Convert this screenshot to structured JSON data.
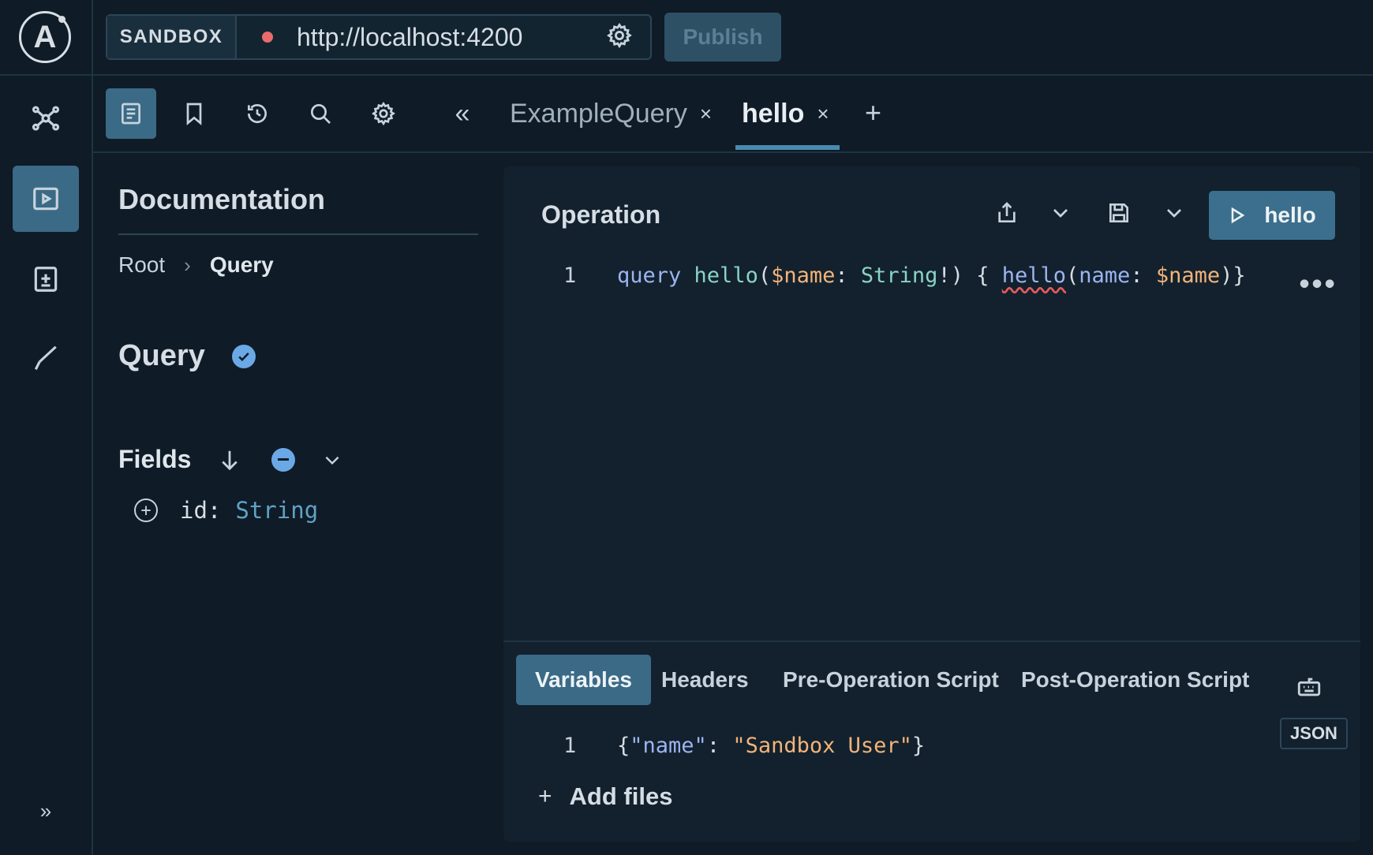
{
  "app": {
    "logo_letter": "A",
    "rail_expand": "»"
  },
  "topbar": {
    "mode_label": "SANDBOX",
    "endpoint_url": "http://localhost:4200",
    "publish_label": "Publish"
  },
  "tabs": [
    {
      "label": "ExampleQuery",
      "close": "×"
    },
    {
      "label": "hello",
      "close": "×"
    }
  ],
  "toolrow": {
    "collapse_glyph": "«",
    "new_tab": "+"
  },
  "docs": {
    "title": "Documentation",
    "breadcrumb": [
      "Root",
      "Query"
    ],
    "breadcrumb_sep": "›",
    "type_name": "Query",
    "fields_label": "Fields",
    "fields": [
      {
        "name": "id:",
        "type": "String"
      }
    ]
  },
  "operation": {
    "title": "Operation",
    "run_label": "hello",
    "line_number": "1",
    "code": {
      "kw": "query",
      "name": "hello",
      "open": "(",
      "var": "$name",
      "colon": ": ",
      "type": "String",
      "bang": "!",
      "close": ") { ",
      "field": "hello",
      "arg_open": "(",
      "arg": "name",
      "arg_colon": ": ",
      "arg_val": "$name",
      "end": ")}"
    },
    "more": "•••"
  },
  "bottom_tabs": [
    "Variables",
    "Headers",
    "Pre-Operation Script",
    "Post-Operation Script"
  ],
  "variables": {
    "format_badge": "JSON",
    "line_number": "1",
    "open": "{",
    "key": "\"name\"",
    "colon": ": ",
    "value": "\"Sandbox User\"",
    "close": "}",
    "add_files_label": "Add files",
    "add_files_plus": "+"
  },
  "colors": {
    "background": "#0f1b26",
    "accent": "#3a6a86",
    "status_dot": "#e86b6b",
    "verified": "#6aa9e6"
  },
  "icons": {
    "rail": [
      "schema-icon",
      "explorer-play-icon",
      "checks-add-icon",
      "checkmark-icon"
    ],
    "toolrow": [
      "documentation-icon",
      "bookmark-icon",
      "history-icon",
      "search-icon",
      "settings-icon"
    ]
  }
}
